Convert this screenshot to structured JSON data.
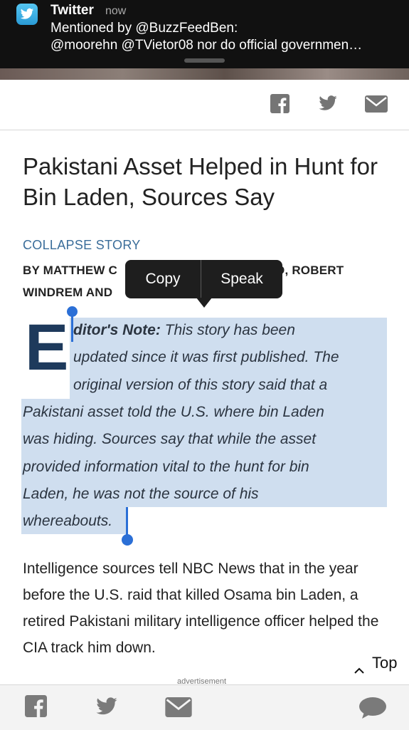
{
  "notification": {
    "app": "Twitter",
    "time": "now",
    "line1": "Mentioned by @BuzzFeedBen:",
    "line2": "@moorehn @TVietor08 nor do official governmen…"
  },
  "share_bar": {
    "icons": [
      "facebook-icon",
      "twitter-icon",
      "mail-icon"
    ]
  },
  "article": {
    "headline": "Pakistani Asset Helped in Hunt for Bin Laden, Sources Say",
    "collapse_label": "COLLAPSE STORY",
    "byline_line1_left": "BY MATTHEW C",
    "byline_line1_right": "O, ROBERT",
    "byline_line2": "WINDREM AND",
    "dropcap": "E",
    "editors_note_label": "ditor's Note:",
    "editors_note_lines": [
      " This story has been",
      "updated since it was first published. The",
      "original version of this story said that a",
      "Pakistani asset told the U.S. where bin Laden",
      "was hiding. Sources say that while the asset",
      "provided information vital to the hunt for bin",
      "Laden, he was not the source of his",
      "whereabouts."
    ],
    "body_paragraph": "Intelligence sources tell NBC News that in the year before the U.S. raid that killed Osama bin Laden, a retired Pakistani military intelligence officer helped the CIA track him down."
  },
  "context_menu": {
    "copy_label": "Copy",
    "speak_label": "Speak"
  },
  "top_button_label": "Top",
  "advertisement_label": "advertisement",
  "toolbar": {
    "icons": [
      "facebook-icon",
      "twitter-icon",
      "mail-icon",
      "comment-icon"
    ]
  },
  "colors": {
    "selection": "#cfdeef",
    "handle": "#2b6fd6",
    "link": "#3a6d9a",
    "dropcap": "#1e3a5c"
  }
}
